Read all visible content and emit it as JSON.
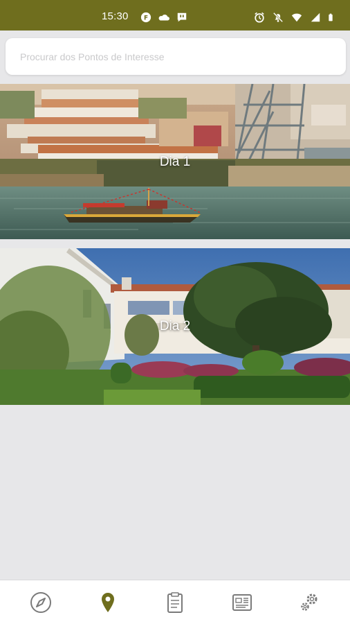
{
  "status_bar": {
    "time": "15:30",
    "background_color": "#6f6e1e",
    "left_icons": [
      "app-notification-icon",
      "cloud-icon",
      "message-icon"
    ],
    "right_icons": [
      "alarm-icon",
      "mute-icon",
      "wifi-icon",
      "signal-icon",
      "battery-icon"
    ]
  },
  "search": {
    "placeholder": "Procurar dos Pontos de Interesse",
    "value": ""
  },
  "days": [
    {
      "label": "Dia 1",
      "image": "porto-riverside-rabelo-boat"
    },
    {
      "label": "Dia 2",
      "image": "garden-with-white-building"
    }
  ],
  "bottom_nav": {
    "items": [
      {
        "icon": "compass-icon",
        "active": false
      },
      {
        "icon": "map-pin-icon",
        "active": true
      },
      {
        "icon": "clipboard-icon",
        "active": false
      },
      {
        "icon": "newspaper-icon",
        "active": false
      },
      {
        "icon": "settings-gears-icon",
        "active": false
      }
    ],
    "active_color": "#6f6e1e",
    "inactive_color": "#7a7a7a"
  }
}
